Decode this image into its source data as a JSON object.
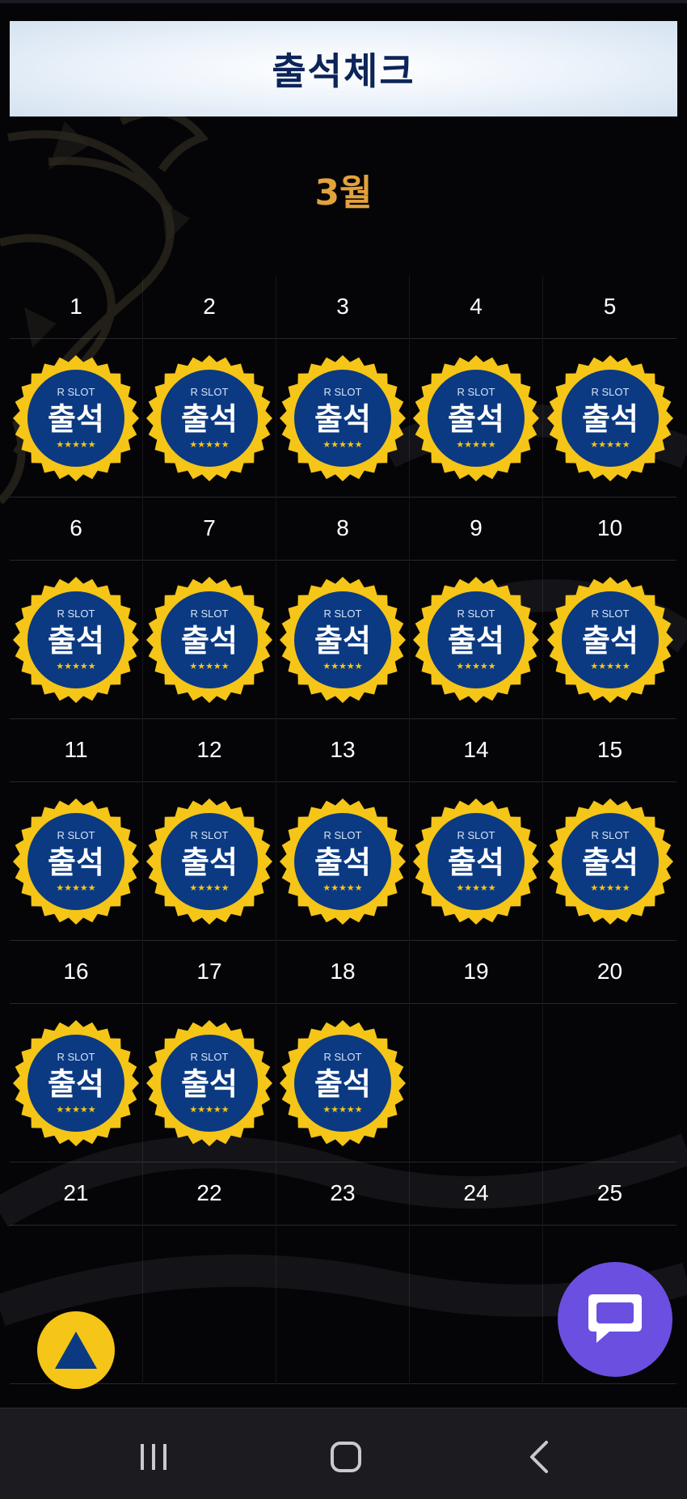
{
  "header": {
    "title": "출석체크"
  },
  "calendar": {
    "month_label": "3월",
    "days": [
      {
        "date": "1",
        "attended": true
      },
      {
        "date": "2",
        "attended": true
      },
      {
        "date": "3",
        "attended": true
      },
      {
        "date": "4",
        "attended": true
      },
      {
        "date": "5",
        "attended": true
      },
      {
        "date": "6",
        "attended": true
      },
      {
        "date": "7",
        "attended": true
      },
      {
        "date": "8",
        "attended": true
      },
      {
        "date": "9",
        "attended": true
      },
      {
        "date": "10",
        "attended": true
      },
      {
        "date": "11",
        "attended": true
      },
      {
        "date": "12",
        "attended": true
      },
      {
        "date": "13",
        "attended": true
      },
      {
        "date": "14",
        "attended": true
      },
      {
        "date": "15",
        "attended": true
      },
      {
        "date": "16",
        "attended": true
      },
      {
        "date": "17",
        "attended": true
      },
      {
        "date": "18",
        "attended": true
      },
      {
        "date": "19",
        "attended": false
      },
      {
        "date": "20",
        "attended": false
      },
      {
        "date": "21",
        "attended": false
      },
      {
        "date": "22",
        "attended": false
      },
      {
        "date": "23",
        "attended": false
      },
      {
        "date": "24",
        "attended": false
      },
      {
        "date": "25",
        "attended": false
      }
    ]
  },
  "badge": {
    "brand": "R SLOT",
    "label": "출석",
    "stars": "★★★★★",
    "colors": {
      "rim": "#f5c518",
      "fill": "#0b3a82",
      "text": "#ffffff",
      "brand_text": "#d7e3f7",
      "stars": "#f5c518"
    }
  },
  "floating": {
    "scroll_top_icon": "up-triangle-icon",
    "chat_icon": "chat-bubble-icon",
    "colors": {
      "scroll_top": "#f5c518",
      "chat": "#6a4fe0"
    }
  },
  "navbar": {
    "icons": [
      "recent-apps-icon",
      "home-icon",
      "back-icon"
    ]
  },
  "colors": {
    "background": "#050507",
    "month": "#e2a23c",
    "title": "#0c2458"
  }
}
